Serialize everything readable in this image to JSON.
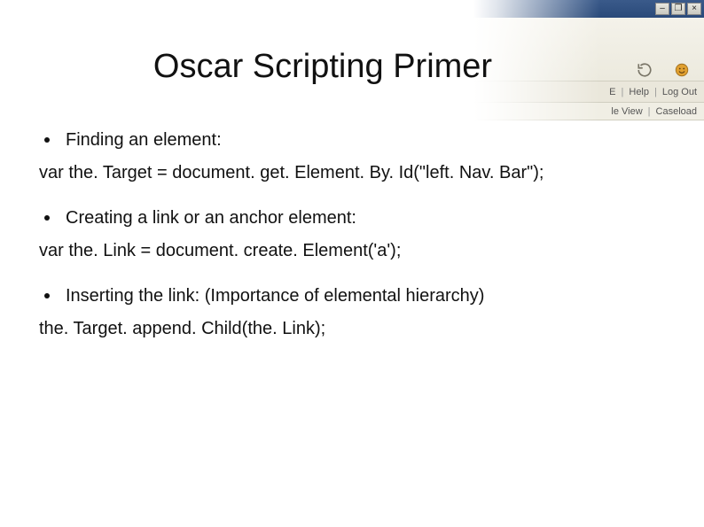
{
  "title": "Oscar Scripting Primer",
  "bullets": [
    {
      "label": "Finding an element:",
      "code": "var the. Target = document. get. Element. By. Id(\"left. Nav. Bar\");"
    },
    {
      "label": "Creating a link or an anchor element:",
      "code": "var the. Link = document. create. Element('a');"
    },
    {
      "label": "Inserting the link: (Importance of elemental hierarchy)",
      "code": "the. Target. append. Child(the. Link);"
    }
  ],
  "bg": {
    "links": {
      "e": "E",
      "help": "Help",
      "logout": "Log Out",
      "view": "le View",
      "caseload": "Caseload"
    },
    "separator": "|"
  }
}
